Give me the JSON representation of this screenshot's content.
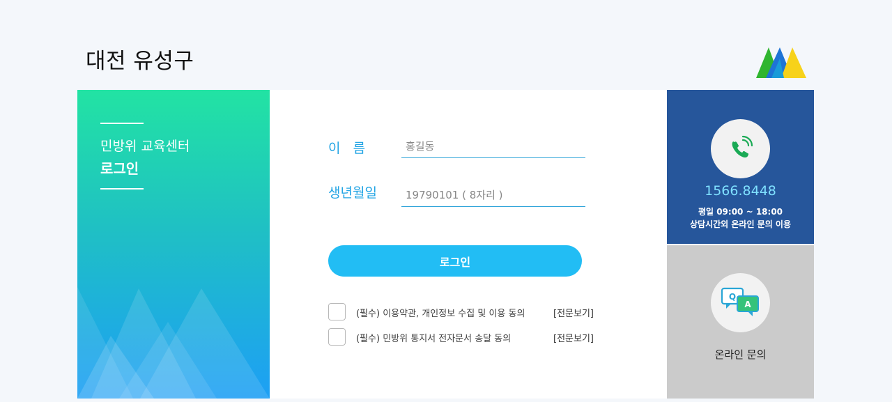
{
  "header": {
    "title": "대전 유성구"
  },
  "left_panel": {
    "subtitle": "민방위 교육센터",
    "title": "로그인"
  },
  "form": {
    "name_label": "이   름",
    "name_placeholder": "홍길동",
    "birth_label": "생년월일",
    "birth_placeholder": "19790101 ( 8자리 )",
    "login_button": "로그인"
  },
  "agreements": [
    {
      "required": "(필수)",
      "text": "이용약관, 개인정보 수집 및 이용 동의",
      "view": "[전문보기]"
    },
    {
      "required": "(필수)",
      "text": "민방위 통지서 전자문서 송달 동의",
      "view": "[전문보기]"
    }
  ],
  "contact": {
    "icon": "phone-icon",
    "phone": "1566.8448",
    "hours_line1": "평일 09:00 ~ 18:00",
    "hours_line2": "상담시간외 온라인 문의 이용"
  },
  "inquiry": {
    "icon": "qa-chat-icon",
    "label": "온라인 문의"
  },
  "colors": {
    "accent": "#22bdf4",
    "label_blue": "#22a4e4",
    "contact_bg": "#26569b",
    "inquiry_bg": "#cbcbcb",
    "gradient_top": "#22e3a3",
    "gradient_bottom": "#1d9ff5"
  }
}
